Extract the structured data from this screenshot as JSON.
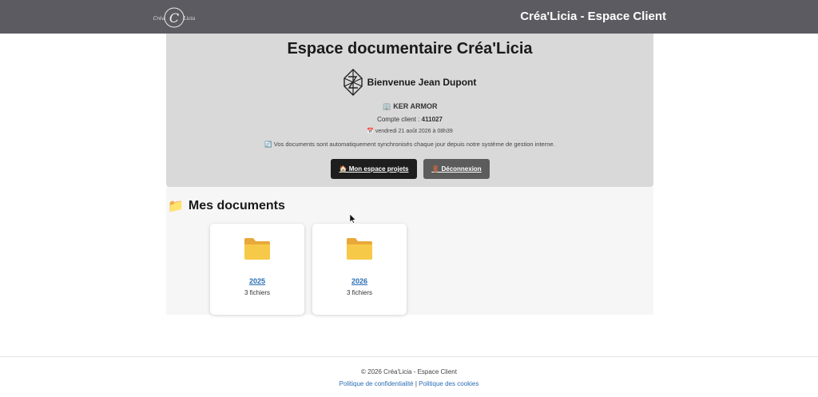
{
  "header": {
    "logo_text": "Créa'Licia",
    "title": "Créa'Licia - Espace Client"
  },
  "hero": {
    "title": "Espace documentaire Créa'Licia",
    "welcome": "Bienvenue Jean Dupont",
    "company_icon": "🏢",
    "company": "KER ARMOR",
    "account_label": "Compte client :",
    "account_number": "411027",
    "date_icon": "📅",
    "date": "vendredi 21 août 2026 à 08h39",
    "sync_icon": "🔄",
    "sync_text": "Vos documents sont automatiquement synchronisés chaque jour depuis notre système de gestion interne.",
    "projects_button": "🏠 Mon espace projets",
    "logout_button": "🚪 Déconnexion"
  },
  "documents": {
    "title_icon": "📁",
    "title": "Mes documents",
    "folders": [
      {
        "name": "2025",
        "count": "3 fichiers"
      },
      {
        "name": "2026",
        "count": "3 fichiers"
      }
    ]
  },
  "footer": {
    "copyright": "© 2026 Créa'Licia - Espace Client",
    "privacy_link": "Politique de confidentialité",
    "separator": "|",
    "cookies_link": "Politique des cookies"
  }
}
